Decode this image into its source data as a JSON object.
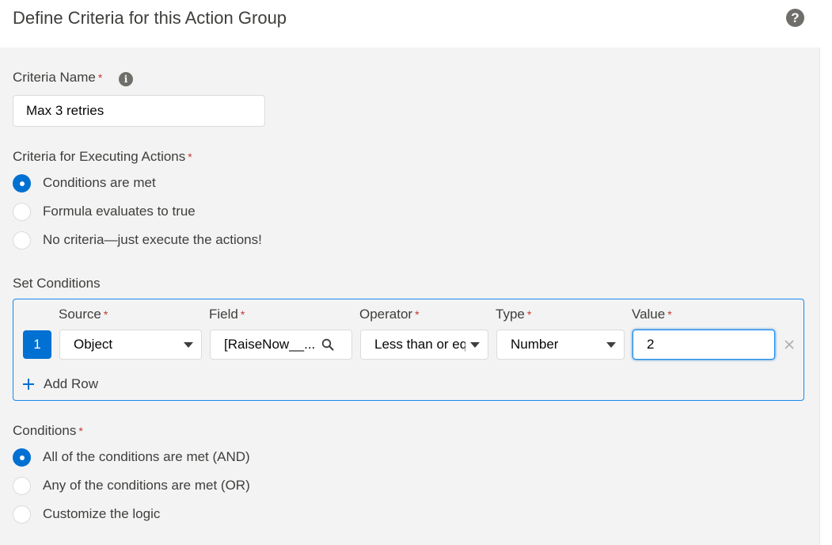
{
  "header": {
    "title": "Define Criteria for this Action Group",
    "help_icon": "question-circle-icon"
  },
  "criteria_name": {
    "label": "Criteria Name",
    "required_mark": "*",
    "info_glyph": "i",
    "value": "Max 3 retries"
  },
  "executing": {
    "label": "Criteria for Executing Actions",
    "required_mark": "*",
    "options": [
      {
        "label": "Conditions are met",
        "checked": true
      },
      {
        "label": "Formula evaluates to true",
        "checked": false
      },
      {
        "label": "No criteria—just execute the actions!",
        "checked": false
      }
    ]
  },
  "set_conditions": {
    "label": "Set Conditions",
    "columns": {
      "source": "Source",
      "field": "Field",
      "operator": "Operator",
      "type": "Type",
      "value": "Value"
    },
    "required_mark": "*",
    "rows": [
      {
        "number": "1",
        "source": "Object",
        "field": "[RaiseNow__...",
        "operator": "Less than or equ",
        "type": "Number",
        "value": "2"
      }
    ],
    "add_row_label": "Add Row"
  },
  "conditions": {
    "label": "Conditions",
    "required_mark": "*",
    "options": [
      {
        "label": "All of the conditions are met (AND)",
        "checked": true
      },
      {
        "label": "Any of the conditions are met (OR)",
        "checked": false
      },
      {
        "label": "Customize the logic",
        "checked": false
      }
    ]
  },
  "colors": {
    "accent": "#0070d2",
    "focus_border": "#1589ee",
    "required": "#c23934",
    "panel_bg": "#f3f3f3"
  }
}
